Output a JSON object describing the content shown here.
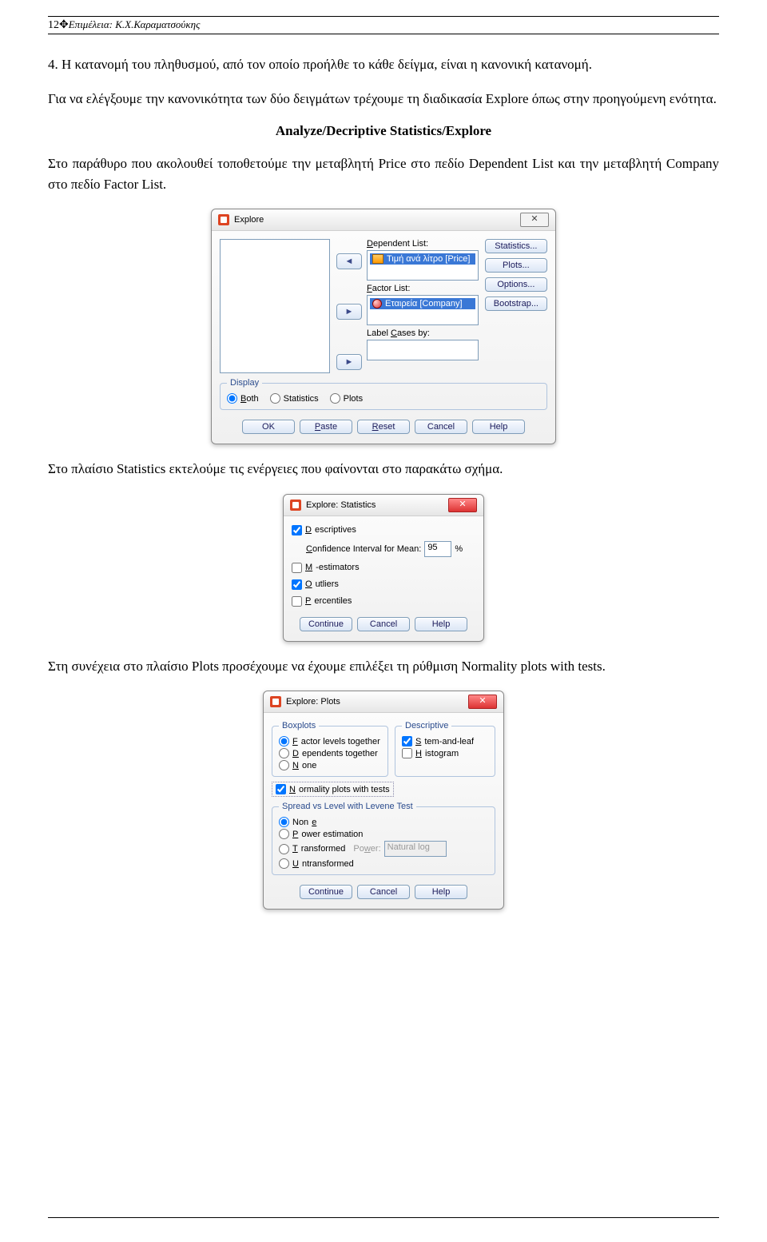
{
  "header": {
    "page_number": "12",
    "dagger": "✥",
    "credit": "Επιμέλεια:  Κ.Χ.Καραματσούκης"
  },
  "para1": "4.  Η κατανομή του πληθυσμού, από τον οποίο προήλθε το κάθε δείγμα, είναι η κανονική κατανομή.",
  "para2": "Για να ελέγξουμε την κανονικότητα των δύο δειγμάτων τρέχουμε τη διαδικασία Explore όπως στην προηγούμενη ενότητα.",
  "menu_path": "Analyze/Decriptive Statistics/Explore",
  "para3": "Στο παράθυρο που ακολουθεί τοποθετούμε την μεταβλητή Price στο πεδίο Dependent List και την μεταβλητή Company στο πεδίο Factor List.",
  "para4": "Στο πλαίσιο Statistics εκτελούμε τις ενέργειες που φαίνονται στο παρακάτω σχήμα.",
  "para5": "Στη συνέχεια στο πλαίσιο Plots προσέχουμε να έχουμε επιλέξει τη ρύθμιση Normality plots with tests.",
  "explore": {
    "title": "Explore",
    "close_glyph": "✕",
    "dep_label": "Dependent List:",
    "dep_var": "Τιμή ανά λίτρο [Price]",
    "factor_label": "Factor List:",
    "factor_var": "Εταιρεία [Company]",
    "labelcases": "Label Cases by:",
    "arrow_back": "◄",
    "arrow_fwd": "►",
    "side": {
      "statistics": "Statistics...",
      "plots": "Plots...",
      "options": "Options...",
      "bootstrap": "Bootstrap..."
    },
    "display": {
      "legend": "Display",
      "both": "Both",
      "statistics": "Statistics",
      "plots": "Plots"
    },
    "buttons": {
      "ok": "OK",
      "paste": "Paste",
      "reset": "Reset",
      "cancel": "Cancel",
      "help": "Help"
    }
  },
  "stats": {
    "title": "Explore: Statistics",
    "close_glyph": "✕",
    "descriptives": "Descriptives",
    "conf_label": "Confidence Interval for Mean:",
    "conf_val": "95",
    "pct": "%",
    "m_est": "M-estimators",
    "outliers": "Outliers",
    "percentiles": "Percentiles",
    "buttons": {
      "continue": "Continue",
      "cancel": "Cancel",
      "help": "Help"
    }
  },
  "plots": {
    "title": "Explore: Plots",
    "close_glyph": "✕",
    "boxplots": {
      "legend": "Boxplots",
      "factor": "Factor levels together",
      "dep": "Dependents together",
      "none": "None"
    },
    "descriptive": {
      "legend": "Descriptive",
      "stem": "Stem-and-leaf",
      "hist": "Histogram"
    },
    "norm": "Normality plots with tests",
    "spread": {
      "legend": "Spread vs Level with Levene Test",
      "none": "None",
      "power_est": "Power estimation",
      "transformed": "Transformed",
      "power_label": "Power:",
      "power_val": "Natural log",
      "untransformed": "Untransformed"
    },
    "buttons": {
      "continue": "Continue",
      "cancel": "Cancel",
      "help": "Help"
    }
  }
}
